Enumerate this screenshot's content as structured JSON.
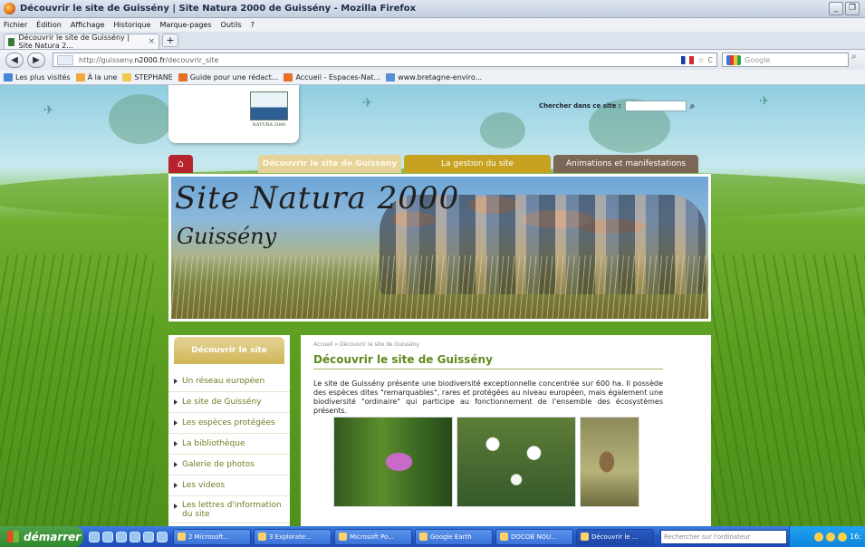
{
  "window": {
    "title": "Découvrir le site de Guissény | Site Natura 2000 de Guissény - Mozilla Firefox",
    "controls": [
      "_",
      "❐"
    ]
  },
  "menu": [
    "Fichier",
    "Édition",
    "Affichage",
    "Historique",
    "Marque-pages",
    "Outils",
    "?"
  ],
  "tabs": [
    {
      "label": "Découvrir le site de Guissény | Site Natura 2...",
      "close": "×"
    }
  ],
  "newtab": "+",
  "nav": {
    "back": "◀",
    "forward": "▶",
    "url_prefix": "http://guisseny.",
    "url_strong": "n2000.fr",
    "url_suffix": "/decouvrir_site",
    "star": "☆",
    "reload": "C",
    "search_placeholder": "Google",
    "search_go": "⌕"
  },
  "bookmarks": [
    {
      "label": "Les plus visités",
      "color": "#4a84d6"
    },
    {
      "label": "À la une",
      "color": "#f2a93b"
    },
    {
      "label": "STEPHANE",
      "color": "#f2c94c"
    },
    {
      "label": "Guide pour une rédact...",
      "color": "#e6702a"
    },
    {
      "label": "Accueil - Espaces-Nat...",
      "color": "#e6702a"
    },
    {
      "label": "www.bretagne-enviro...",
      "color": "#5a8fd6"
    }
  ],
  "site": {
    "logo_text": "NATURA 2000",
    "search_label": "Chercher dans ce site :",
    "search_icon": "⌕",
    "home_icon": "⌂",
    "menu": [
      "Découvrir le site de Guissény",
      "La gestion du site",
      "Animations et manifestations"
    ],
    "banner_line1": "Site Natura 2000",
    "banner_line2": "Guissény",
    "sidebar": {
      "heading": "Découvrir le site",
      "items": [
        "Un réseau européen",
        "Le site de Guissény",
        "Les espèces protégées",
        "La bibliothèque",
        "Galerie de photos",
        "Les videos",
        "Les lettres d'information du site"
      ]
    },
    "breadcrumb": "Accueil » Découvrir le site de Guissény",
    "page_title": "Découvrir le site de Guissény",
    "intro": "Le site de Guissény présente une biodiversité exceptionnelle concentrée sur 600 ha. Il possède des espèces dites \"remarquables\", rares et protégées au niveau européen, mais également une biodiversité \"ordinaire\" qui participe au fonctionnement de l'ensemble des écosystèmes présents."
  },
  "taskbar": {
    "start": "démarrer",
    "tasks": [
      "2 Microsoft...",
      "3 Explorate...",
      "Microsoft Po...",
      "Google Earth",
      "DOCOB NOU...",
      "Découvrir le ..."
    ],
    "search_placeholder": "Rechercher sur l'ordinateur",
    "clock": "16:"
  }
}
